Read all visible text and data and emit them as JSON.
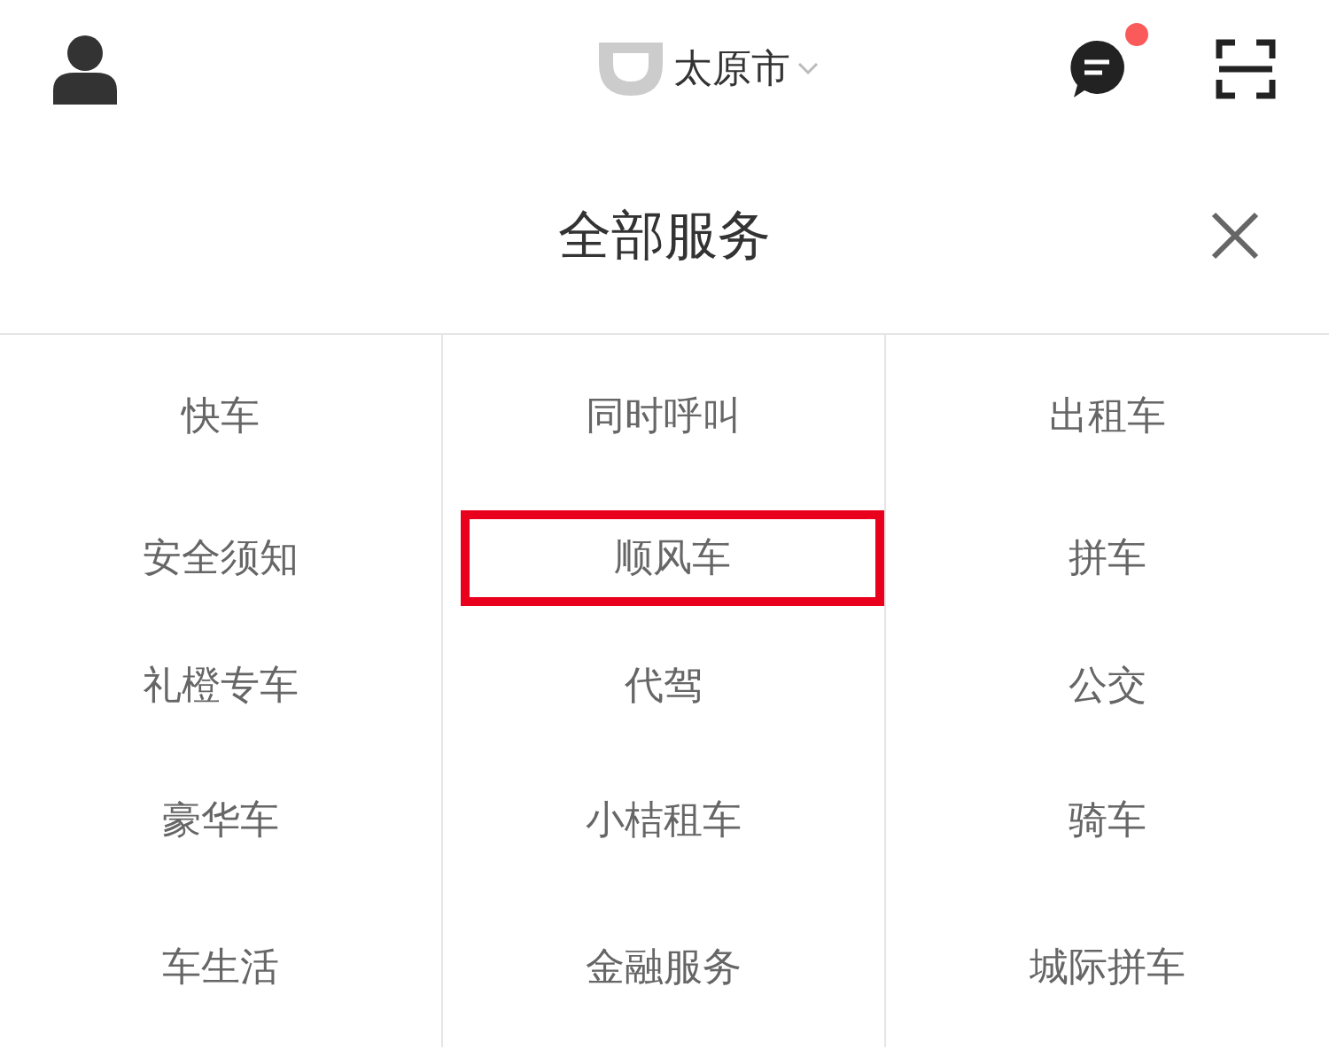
{
  "header": {
    "city": "太原市",
    "has_new_message": true
  },
  "title": "全部服务",
  "services": [
    {
      "label": "快车",
      "highlighted": false
    },
    {
      "label": "同时呼叫",
      "highlighted": false
    },
    {
      "label": "出租车",
      "highlighted": false
    },
    {
      "label": "安全须知",
      "highlighted": false
    },
    {
      "label": "顺风车",
      "highlighted": true
    },
    {
      "label": "拼车",
      "highlighted": false
    },
    {
      "label": "礼橙专车",
      "highlighted": false
    },
    {
      "label": "代驾",
      "highlighted": false
    },
    {
      "label": "公交",
      "highlighted": false
    },
    {
      "label": "豪华车",
      "highlighted": false
    },
    {
      "label": "小桔租车",
      "highlighted": false
    },
    {
      "label": "骑车",
      "highlighted": false
    },
    {
      "label": "车生活",
      "highlighted": false
    },
    {
      "label": "金融服务",
      "highlighted": false
    },
    {
      "label": "城际拼车",
      "highlighted": false
    }
  ]
}
